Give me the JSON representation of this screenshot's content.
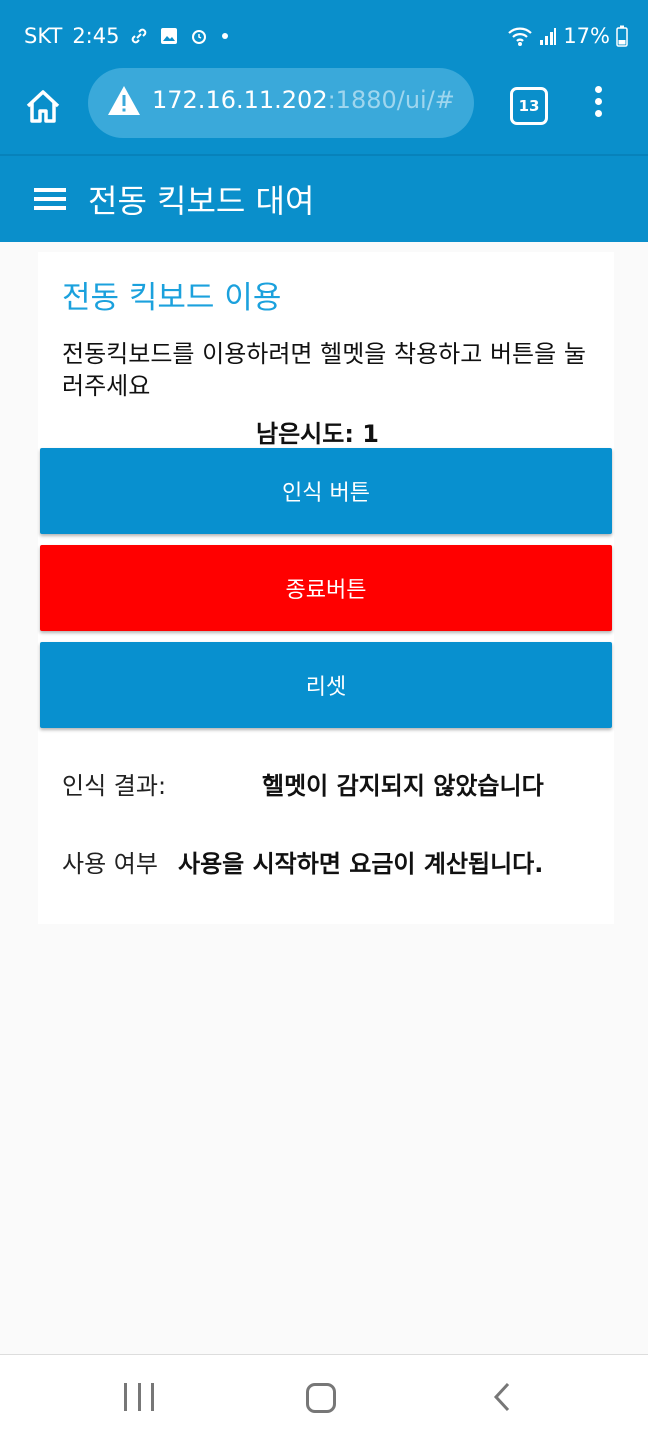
{
  "status": {
    "carrier": "SKT",
    "time": "2:45",
    "battery": "17%"
  },
  "browser": {
    "url_main": "172.16.11.202",
    "url_rest": ":1880/ui/#",
    "tab_count": "13"
  },
  "header": {
    "title": "전동 킥보드 대여"
  },
  "card": {
    "title": "전동 킥보드 이용",
    "description": "전동킥보드를 이용하려면 헬멧을 착용하고 버튼을 눌러주세요",
    "attempts": "남은시도: 1"
  },
  "buttons": {
    "detect": "인식 버튼",
    "end": "종료버튼",
    "reset": "리셋"
  },
  "result": {
    "label": "인식 결과:",
    "value": "헬멧이 감지되지 않았습니다"
  },
  "usage": {
    "label": "사용 여부",
    "value": "사용을 시작하면 요금이 계산됩니다."
  },
  "colors": {
    "primary": "#0a8fcb",
    "danger": "#ff0000",
    "title_accent": "#1ba1dd"
  }
}
